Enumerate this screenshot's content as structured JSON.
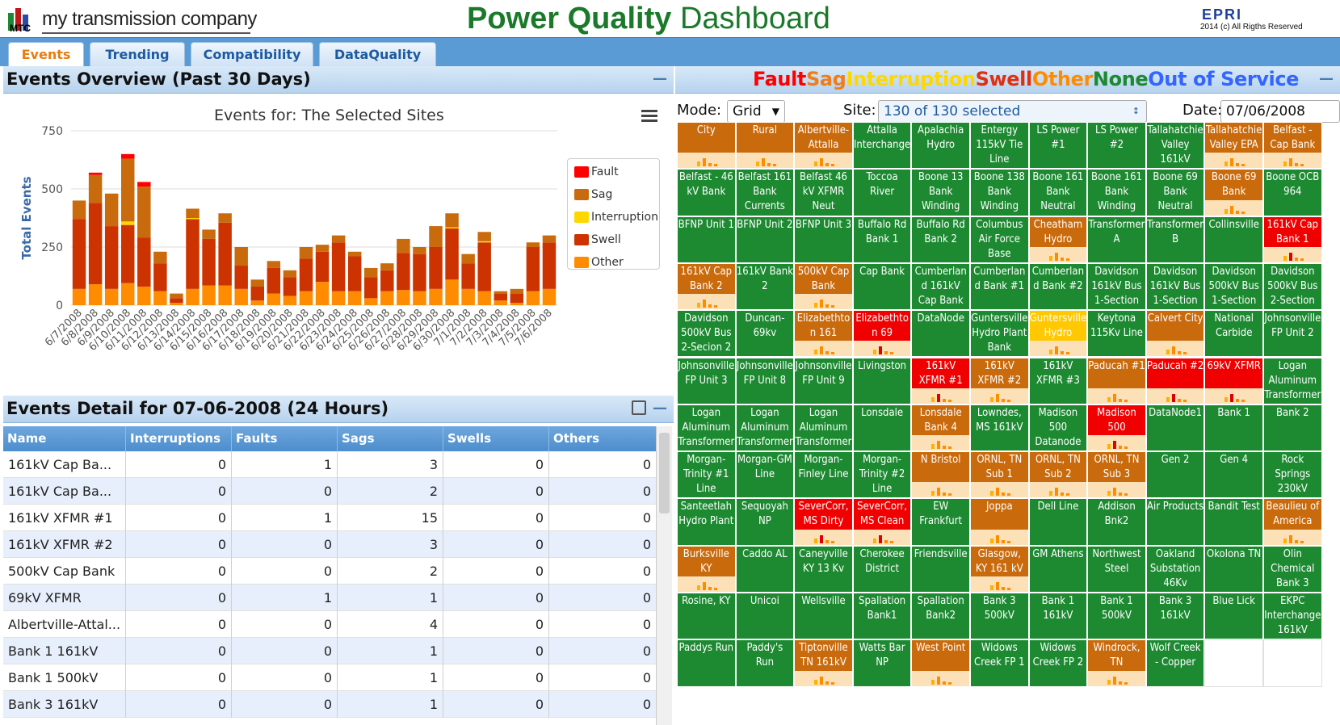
{
  "header": {
    "company": "my transmission company",
    "mtc": "MTC",
    "title_bold": "Power Quality",
    "title_rest": "Dashboard",
    "epri": "EPRI",
    "copyright": "2014 (c) All Rigths Reserved"
  },
  "tabs": [
    {
      "label": "Events",
      "active": true
    },
    {
      "label": "Trending"
    },
    {
      "label": "Compatibility"
    },
    {
      "label": "DataQuality"
    }
  ],
  "overview": {
    "heading": "Events Overview (Past 30 Days)",
    "chart_title": "Events for: The Selected Sites"
  },
  "chart_data": {
    "type": "bar",
    "stacked": true,
    "title": "Events for: The Selected Sites",
    "ylabel": "Total Events",
    "ylim": [
      0,
      750
    ],
    "yticks": [
      0,
      250,
      500,
      750
    ],
    "categories": [
      "6/7/2008",
      "6/8/2008",
      "6/9/2008",
      "6/10/2008",
      "6/11/2008",
      "6/12/2008",
      "6/13/2008",
      "6/14/2008",
      "6/15/2008",
      "6/16/2008",
      "6/17/2008",
      "6/18/2008",
      "6/19/2008",
      "6/20/2008",
      "6/21/2008",
      "6/22/2008",
      "6/23/2008",
      "6/24/2008",
      "6/25/2008",
      "6/26/2008",
      "6/27/2008",
      "6/28/2008",
      "6/29/2008",
      "6/30/2008",
      "7/1/2008",
      "7/2/2008",
      "7/3/2008",
      "7/4/2008",
      "7/5/2008",
      "7/6/2008"
    ],
    "series": [
      {
        "name": "Fault",
        "color": "#ff0000",
        "values": [
          0,
          10,
          0,
          20,
          20,
          0,
          0,
          0,
          0,
          0,
          0,
          0,
          0,
          0,
          0,
          0,
          0,
          0,
          0,
          0,
          0,
          0,
          0,
          0,
          0,
          0,
          0,
          0,
          0,
          0
        ]
      },
      {
        "name": "Sag",
        "color": "#c96a0c",
        "values": [
          80,
          120,
          140,
          270,
          220,
          50,
          20,
          40,
          40,
          40,
          80,
          30,
          30,
          30,
          50,
          30,
          30,
          20,
          40,
          30,
          60,
          30,
          90,
          60,
          40,
          40,
          10,
          20,
          20,
          30
        ]
      },
      {
        "name": "Interruption",
        "color": "#ffd700",
        "values": [
          0,
          0,
          0,
          15,
          0,
          0,
          0,
          5,
          0,
          0,
          0,
          0,
          0,
          0,
          0,
          0,
          0,
          0,
          0,
          0,
          0,
          0,
          0,
          5,
          0,
          5,
          0,
          0,
          0,
          0
        ]
      },
      {
        "name": "Swell",
        "color": "#cc3300",
        "values": [
          300,
          350,
          270,
          250,
          210,
          120,
          20,
          300,
          200,
          270,
          100,
          60,
          110,
          80,
          140,
          130,
          210,
          150,
          90,
          90,
          160,
          160,
          180,
          220,
          110,
          210,
          30,
          40,
          190,
          200
        ]
      },
      {
        "name": "Other",
        "color": "#ff8c00",
        "values": [
          70,
          90,
          70,
          95,
          80,
          60,
          10,
          70,
          85,
          85,
          70,
          20,
          50,
          40,
          60,
          100,
          60,
          60,
          30,
          60,
          65,
          60,
          70,
          110,
          70,
          60,
          20,
          10,
          60,
          70
        ]
      }
    ]
  },
  "detail": {
    "heading": "Events Detail for 07-06-2008 (24 Hours)",
    "columns": [
      "Name",
      "Interruptions",
      "Faults",
      "Sags",
      "Swells",
      "Others"
    ],
    "rows": [
      [
        "161kV Cap Ba...",
        "0",
        "1",
        "3",
        "0",
        "0"
      ],
      [
        "161kV Cap Ba...",
        "0",
        "0",
        "2",
        "0",
        "0"
      ],
      [
        "161kV XFMR #1",
        "0",
        "1",
        "15",
        "0",
        "0"
      ],
      [
        "161kV XFMR #2",
        "0",
        "0",
        "3",
        "0",
        "0"
      ],
      [
        "500kV Cap Bank",
        "0",
        "0",
        "2",
        "0",
        "0"
      ],
      [
        "69kV XFMR",
        "0",
        "1",
        "1",
        "0",
        "0"
      ],
      [
        "Albertville-Attal...",
        "0",
        "0",
        "4",
        "0",
        "0"
      ],
      [
        "Bank 1 161kV",
        "0",
        "0",
        "1",
        "0",
        "0"
      ],
      [
        "Bank 1 500kV",
        "0",
        "0",
        "1",
        "0",
        "0"
      ],
      [
        "Bank 3 161kV",
        "0",
        "0",
        "1",
        "0",
        "0"
      ]
    ]
  },
  "legend2": [
    {
      "label": "Fault",
      "color": "#ff0000"
    },
    {
      "label": "Sag",
      "color": "#f07d1a"
    },
    {
      "label": "Interruption",
      "color": "#ffd700"
    },
    {
      "label": "Swell",
      "color": "#e03010"
    },
    {
      "label": "Other",
      "color": "#ff8c00"
    },
    {
      "label": "None",
      "color": "#1d8a32"
    },
    {
      "label": "Out of Service",
      "color": "#3366ff"
    }
  ],
  "controls": {
    "mode_label": "Mode:",
    "mode_value": "Grid",
    "site_label": "Site:",
    "site_value": "130 of 130 selected",
    "date_label": "Date:",
    "date_value": "07/06/2008"
  },
  "cells": [
    [
      "City",
      "o"
    ],
    [
      "Rural",
      "o"
    ],
    [
      "Albertville-Attalla",
      "o"
    ],
    [
      "Attalla Interchange",
      "g"
    ],
    [
      "Apalachia Hydro",
      "g"
    ],
    [
      "Entergy 115kV Tie Line",
      "g"
    ],
    [
      "LS Power #1",
      "g"
    ],
    [
      "LS Power #2",
      "g"
    ],
    [
      "Tallahatchie Valley 161kV",
      "g"
    ],
    [
      "Tallahatchie Valley EPA",
      "o"
    ],
    [
      "Belfast - Cap Bank",
      "o"
    ],
    [
      "Belfast - 46 kV Bank",
      "g"
    ],
    [
      "Belfast 161 Bank Currents",
      "g"
    ],
    [
      "Belfast 46 kV XFMR Neut",
      "g"
    ],
    [
      "Toccoa River",
      "g"
    ],
    [
      "Boone 13 Bank Winding",
      "g"
    ],
    [
      "Boone 138 Bank Winding",
      "g"
    ],
    [
      "Boone 161 Bank Neutral",
      "g"
    ],
    [
      "Boone 161 Bank Winding",
      "g"
    ],
    [
      "Boone 69 Bank Neutral",
      "g"
    ],
    [
      "Boone 69 Bank",
      "o"
    ],
    [
      "Boone OCB 964",
      "g"
    ],
    [
      "BFNP Unit 1",
      "g"
    ],
    [
      "BFNP Unit 2",
      "g"
    ],
    [
      "BFNP Unit 3",
      "g"
    ],
    [
      "Buffalo Rd Bank 1",
      "g"
    ],
    [
      "Buffalo Rd Bank 2",
      "g"
    ],
    [
      "Columbus Air Force Base",
      "g"
    ],
    [
      "Cheatham Hydro",
      "o"
    ],
    [
      "Transformer A",
      "g"
    ],
    [
      "Transformer B",
      "g"
    ],
    [
      "Collinsville",
      "g"
    ],
    [
      "161kV Cap Bank 1",
      "r"
    ],
    [
      "161kV Cap Bank 2",
      "o"
    ],
    [
      "161kV Bank 2",
      "g"
    ],
    [
      "500kV Cap Bank",
      "o"
    ],
    [
      "Cap Bank",
      "g"
    ],
    [
      "Cumberland 161kV Cap Bank",
      "g"
    ],
    [
      "Cumberland Bank #1",
      "g"
    ],
    [
      "Cumberland Bank #2",
      "g"
    ],
    [
      "Davidson 161kV Bus 1-Section",
      "g"
    ],
    [
      "Davidson 161kV Bus 1-Section",
      "g"
    ],
    [
      "Davidson 500kV Bus 1-Section",
      "g"
    ],
    [
      "Davidson 500kV Bus 2-Section",
      "g"
    ],
    [
      "Davidson 500kV Bus 2-Secion 2",
      "g"
    ],
    [
      "Duncan-69kv",
      "g"
    ],
    [
      "Elizabethton 161",
      "o"
    ],
    [
      "Elizabethton 69",
      "r"
    ],
    [
      "DataNode",
      "g"
    ],
    [
      "Guntersville Hydro Plant Bank",
      "g"
    ],
    [
      "Guntersville Hydro",
      "y"
    ],
    [
      "Keytona 115Kv Line",
      "g"
    ],
    [
      "Calvert City",
      "o"
    ],
    [
      "National Carbide",
      "g"
    ],
    [
      "Johnsonville FP Unit 2",
      "g"
    ],
    [
      "Johnsonville FP Unit 3",
      "g"
    ],
    [
      "Johnsonville FP Unit 8",
      "g"
    ],
    [
      "Johnsonville FP Unit 9",
      "g"
    ],
    [
      "Livingston",
      "g"
    ],
    [
      "161kV XFMR #1",
      "r"
    ],
    [
      "161kV XFMR #2",
      "o"
    ],
    [
      "161kV XFMR #3",
      "g"
    ],
    [
      "Paducah #1",
      "o"
    ],
    [
      "Paducah #2",
      "r"
    ],
    [
      "69kV XFMR",
      "r"
    ],
    [
      "Logan Aluminum Transformer",
      "g"
    ],
    [
      "Logan Aluminum Transformer",
      "g"
    ],
    [
      "Logan Aluminum Transformer",
      "g"
    ],
    [
      "Logan Aluminum Transformer",
      "g"
    ],
    [
      "Lonsdale",
      "g"
    ],
    [
      "Lonsdale Bank 4",
      "o"
    ],
    [
      "Lowndes, MS 161kV",
      "g"
    ],
    [
      "Madison 500 Datanode",
      "g"
    ],
    [
      "Madison 500",
      "r"
    ],
    [
      "DataNode1",
      "g"
    ],
    [
      "Bank 1",
      "g"
    ],
    [
      "Bank 2",
      "g"
    ],
    [
      "Morgan-Trinity #1 Line",
      "g"
    ],
    [
      "Morgan-GM Line",
      "g"
    ],
    [
      "Morgan-Finley Line",
      "g"
    ],
    [
      "Morgan-Trinity #2 Line",
      "g"
    ],
    [
      "N Bristol",
      "o"
    ],
    [
      "ORNL, TN Sub 1",
      "o"
    ],
    [
      "ORNL, TN Sub 2",
      "o"
    ],
    [
      "ORNL, TN Sub 3",
      "o"
    ],
    [
      "Gen 2",
      "g"
    ],
    [
      "Gen 4",
      "g"
    ],
    [
      "Rock Springs 230kV",
      "g"
    ],
    [
      "Santeetlah Hydro Plant",
      "g"
    ],
    [
      "Sequoyah NP",
      "g"
    ],
    [
      "SeverCorr, MS Dirty",
      "r"
    ],
    [
      "SeverCorr, MS Clean",
      "r"
    ],
    [
      "EW Frankfurt",
      "g"
    ],
    [
      "Joppa",
      "o"
    ],
    [
      "Dell Line",
      "g"
    ],
    [
      "Addison Bnk2",
      "g"
    ],
    [
      "Air Products",
      "g"
    ],
    [
      "Bandit Test",
      "g"
    ],
    [
      "Beaulieu of America",
      "o"
    ],
    [
      "Burksville KY",
      "o"
    ],
    [
      "Caddo AL",
      "g"
    ],
    [
      "Caneyville KY 13 Kv",
      "g"
    ],
    [
      "Cherokee District",
      "g"
    ],
    [
      "Friendsville",
      "g"
    ],
    [
      "Glasgow, KY 161 kV",
      "o"
    ],
    [
      "GM Athens",
      "g"
    ],
    [
      "Northwest Steel",
      "g"
    ],
    [
      "Oakland Substation 46Kv",
      "g"
    ],
    [
      "Okolona TN",
      "g"
    ],
    [
      "Olin Chemical Bank 3",
      "g"
    ],
    [
      "Rosine, KY",
      "g"
    ],
    [
      "Unicoi",
      "g"
    ],
    [
      "Wellsville",
      "g"
    ],
    [
      "Spallation Bank1",
      "g"
    ],
    [
      "Spallation Bank2",
      "g"
    ],
    [
      "Bank 3 500kV",
      "g"
    ],
    [
      "Bank 1 161kV",
      "g"
    ],
    [
      "Bank 1 500kV",
      "g"
    ],
    [
      "Bank 3 161kV",
      "g"
    ],
    [
      "Blue Lick",
      "g"
    ],
    [
      "EKPC Interchange 161kV",
      "g"
    ],
    [
      "Paddys Run",
      "g"
    ],
    [
      "Paddy's Run",
      "g"
    ],
    [
      "Tiptonville TN 161kV",
      "o"
    ],
    [
      "Watts Bar NP",
      "g"
    ],
    [
      "West Point",
      "o"
    ],
    [
      "Widows Creek FP 1",
      "g"
    ],
    [
      "Widows Creek FP 2",
      "g"
    ],
    [
      "Windrock, TN",
      "o"
    ],
    [
      "Wolf Creek - Copper",
      "g"
    ],
    [
      "",
      ""
    ],
    [
      "",
      ""
    ]
  ],
  "colors": {
    "green": "#1d8a32",
    "orange": "#c96a0c",
    "red": "#f00000",
    "yellow": "#ffc800",
    "tab_blue": "#5a9bd5"
  }
}
